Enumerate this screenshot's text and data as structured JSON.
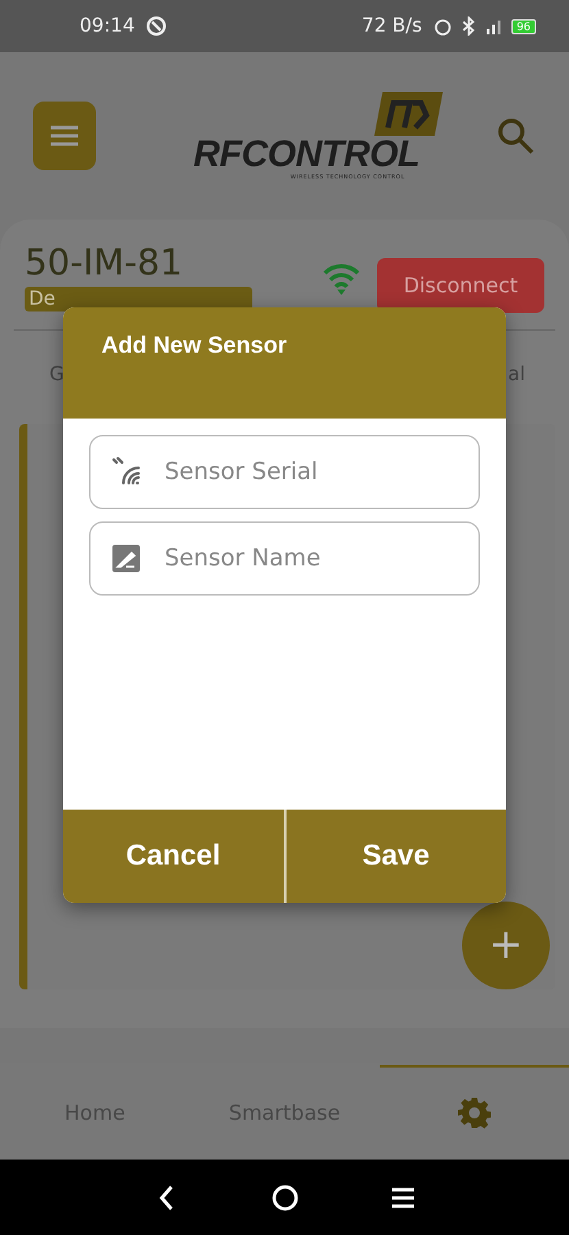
{
  "status_bar": {
    "time": "09:14",
    "speed": "72 B/s",
    "battery": "96"
  },
  "header": {
    "logo_text": "RFCONTROL",
    "logo_tagline": "WIRELESS TECHNOLOGY CONTROL"
  },
  "device": {
    "id": "50-IM-81",
    "badge": "De",
    "connected": true,
    "action": "Disconnect"
  },
  "tabs": [
    {
      "label": "G",
      "selected": false
    },
    {
      "label": "al",
      "selected": false
    }
  ],
  "dialog": {
    "title": "Add New Sensor",
    "fields": [
      {
        "kind": "serial",
        "placeholder": "Sensor Serial"
      },
      {
        "kind": "name",
        "placeholder": "Sensor Name"
      }
    ],
    "buttons": [
      "Cancel",
      "Save"
    ]
  },
  "fab": {
    "label": "+"
  },
  "bottom_nav": [
    {
      "kind": "text",
      "label": "Home",
      "selected": false
    },
    {
      "kind": "text",
      "label": "Smartbase",
      "selected": false
    },
    {
      "kind": "gear",
      "selected": true
    }
  ]
}
